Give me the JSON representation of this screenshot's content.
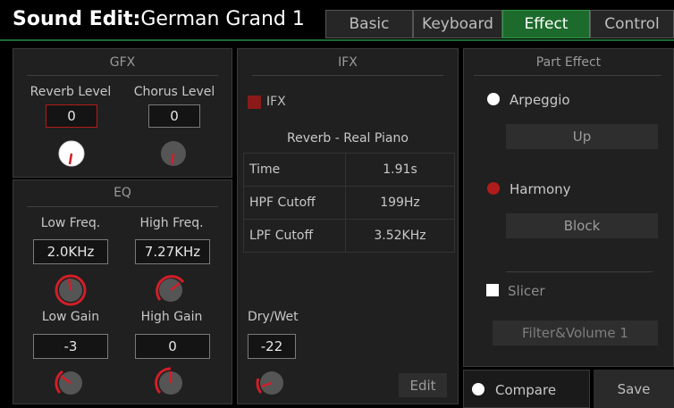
{
  "header": {
    "title_bold": "Sound Edit:",
    "title_name": "German Grand 1",
    "tabs": [
      "Basic",
      "Keyboard",
      "Effect",
      "Control"
    ],
    "active_tab": "Effect"
  },
  "gfx": {
    "title": "GFX",
    "reverb_label": "Reverb Level",
    "reverb_value": "0",
    "chorus_label": "Chorus Level",
    "chorus_value": "0"
  },
  "eq": {
    "title": "EQ",
    "low_freq_label": "Low Freq.",
    "low_freq_value": "2.0KHz",
    "high_freq_label": "High Freq.",
    "high_freq_value": "7.27KHz",
    "low_gain_label": "Low Gain",
    "low_gain_value": "-3",
    "high_gain_label": "High Gain",
    "high_gain_value": "0"
  },
  "ifx": {
    "title": "IFX",
    "toggle_label": "IFX",
    "preset": "Reverb - Real Piano",
    "params": [
      {
        "name": "Time",
        "value": "1.91s"
      },
      {
        "name": "HPF Cutoff",
        "value": "199Hz"
      },
      {
        "name": "LPF Cutoff",
        "value": "3.52KHz"
      }
    ],
    "dry_wet_label": "Dry/Wet",
    "dry_wet_value": "-22",
    "edit_label": "Edit"
  },
  "part_effect": {
    "title": "Part Effect",
    "arpeggio_label": "Arpeggio",
    "arpeggio_value": "Up",
    "harmony_label": "Harmony",
    "harmony_value": "Block",
    "slicer_label": "Slicer",
    "slicer_value": "Filter&Volume 1"
  },
  "footer": {
    "compare_label": "Compare",
    "save_label": "Save"
  },
  "colors": {
    "accent_green": "#1d6b2c",
    "accent_red": "#b01c1c",
    "knob_indicator": "#e0202a"
  },
  "icons": [
    "radio-dot-icon",
    "checkbox-icon",
    "knob-icon"
  ]
}
